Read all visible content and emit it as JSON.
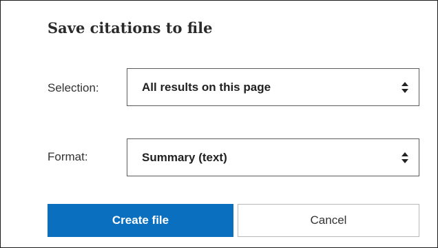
{
  "dialog": {
    "title": "Save citations to file"
  },
  "fields": {
    "selection": {
      "label": "Selection:",
      "value": "All results on this page",
      "icon": "sort-updown-icon"
    },
    "format": {
      "label": "Format:",
      "value": "Summary (text)",
      "icon": "sort-updown-icon"
    }
  },
  "actions": {
    "create_label": "Create file",
    "cancel_label": "Cancel"
  },
  "colors": {
    "primary": "#0a6fbf",
    "border": "#5a5a5a",
    "text": "#212121"
  }
}
